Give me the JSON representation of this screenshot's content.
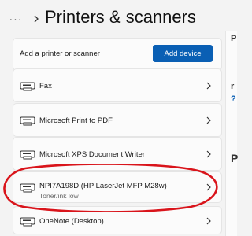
{
  "header": {
    "more_label": "···",
    "title": "Printers & scanners"
  },
  "add_device": {
    "label": "Add a printer or scanner",
    "button_label": "Add device"
  },
  "devices": [
    {
      "name": "Fax",
      "status": ""
    },
    {
      "name": "Microsoft Print to PDF",
      "status": ""
    },
    {
      "name": "Microsoft XPS Document Writer",
      "status": ""
    },
    {
      "name": "NPI7A198D (HP LaserJet MFP M28w)",
      "status": "Toner/ink low"
    },
    {
      "name": "OneNote (Desktop)",
      "status": ""
    }
  ],
  "edge_fragments": [
    "P",
    "r",
    "?",
    "P"
  ],
  "colors": {
    "accent": "#0a5fb4",
    "annotation_circle": "#d9141b"
  },
  "icons": {
    "device": "printer-icon",
    "chevron": "chevron-right-icon",
    "breadcrumb": "chevron-right-icon"
  }
}
